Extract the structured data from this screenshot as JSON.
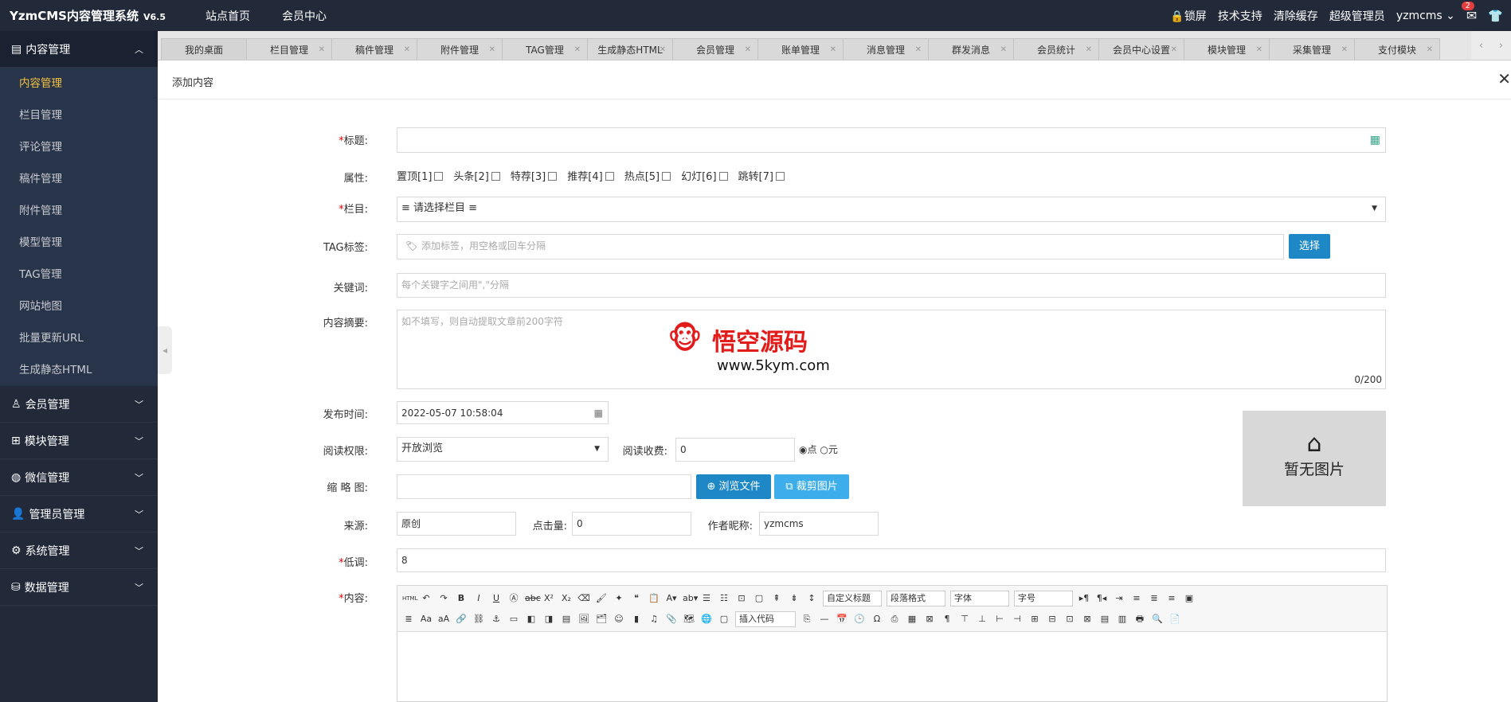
{
  "app": {
    "title": "YzmCMS内容管理系统",
    "version": "V6.5",
    "nav": [
      "站点首页",
      "会员中心"
    ],
    "lock": "锁屏",
    "support": "技术支持",
    "clear_cache": "清除缓存",
    "role": "超级管理员",
    "user": "yzmcms",
    "mail_badge": "2"
  },
  "sidebar": {
    "groups": [
      {
        "label": "内容管理",
        "open": true,
        "items": [
          {
            "label": "内容管理",
            "active": true
          },
          {
            "label": "栏目管理"
          },
          {
            "label": "评论管理"
          },
          {
            "label": "稿件管理"
          },
          {
            "label": "附件管理"
          },
          {
            "label": "模型管理"
          },
          {
            "label": "TAG管理"
          },
          {
            "label": "网站地图"
          },
          {
            "label": "批量更新URL"
          },
          {
            "label": "生成静态HTML"
          }
        ]
      },
      {
        "label": "会员管理"
      },
      {
        "label": "模块管理"
      },
      {
        "label": "微信管理"
      },
      {
        "label": "管理员管理"
      },
      {
        "label": "系统管理"
      },
      {
        "label": "数据管理"
      }
    ]
  },
  "tabs": [
    "我的桌面",
    "栏目管理",
    "稿件管理",
    "附件管理",
    "TAG管理",
    "生成静态HTML",
    "会员管理",
    "账单管理",
    "消息管理",
    "群发消息",
    "会员统计",
    "会员中心设置",
    "模块管理",
    "采集管理",
    "支付模块"
  ],
  "page": {
    "title": "添加内容"
  },
  "form": {
    "title_label": "标题:",
    "attr_label": "属性:",
    "attrs": [
      "置顶[1]",
      "头条[2]",
      "特荐[3]",
      "推荐[4]",
      "热点[5]",
      "幻灯[6]",
      "跳转[7]"
    ],
    "column_label": "栏目:",
    "column_value": "≡ 请选择栏目 ≡",
    "tag_label": "TAG标签:",
    "tag_placeholder": "添加标签，用空格或回车分隔",
    "tag_button": "选择",
    "keyword_label": "关键词:",
    "keyword_placeholder": "每个关键字之间用\",\"分隔",
    "summary_label": "内容摘要:",
    "summary_placeholder": "如不填写，则自动提取文章前200字符",
    "summary_count": "0/200",
    "time_label": "发布时间:",
    "time_value": "2022-05-07 10:58:04",
    "perm_label": "阅读权限:",
    "perm_value": "开放浏览",
    "fee_label": "阅读收费:",
    "fee_value": "0",
    "unit_point": "点",
    "unit_yuan": "元",
    "thumb_label": "缩 略 图:",
    "browse_button": "浏览文件",
    "crop_button": "裁剪图片",
    "no_image": "暂无图片",
    "source_label": "来源:",
    "source_value": "原创",
    "clicks_label": "点击量:",
    "clicks_value": "0",
    "author_label": "作者昵称:",
    "author_value": "yzmcms",
    "lowkey_label": "低调:",
    "lowkey_value": "8",
    "content_label": "内容:"
  },
  "editor": {
    "heading": "自定义标题",
    "paragraph": "段落格式",
    "font": "字体",
    "size": "字号",
    "insert_code": "插入代码"
  },
  "watermark": {
    "title": "悟空源码",
    "url": "www.5kym.com"
  },
  "colors": {
    "dark": "#222a3a",
    "active": "#f5c342",
    "primary": "#1e88c7",
    "light_btn": "#3daee9"
  }
}
